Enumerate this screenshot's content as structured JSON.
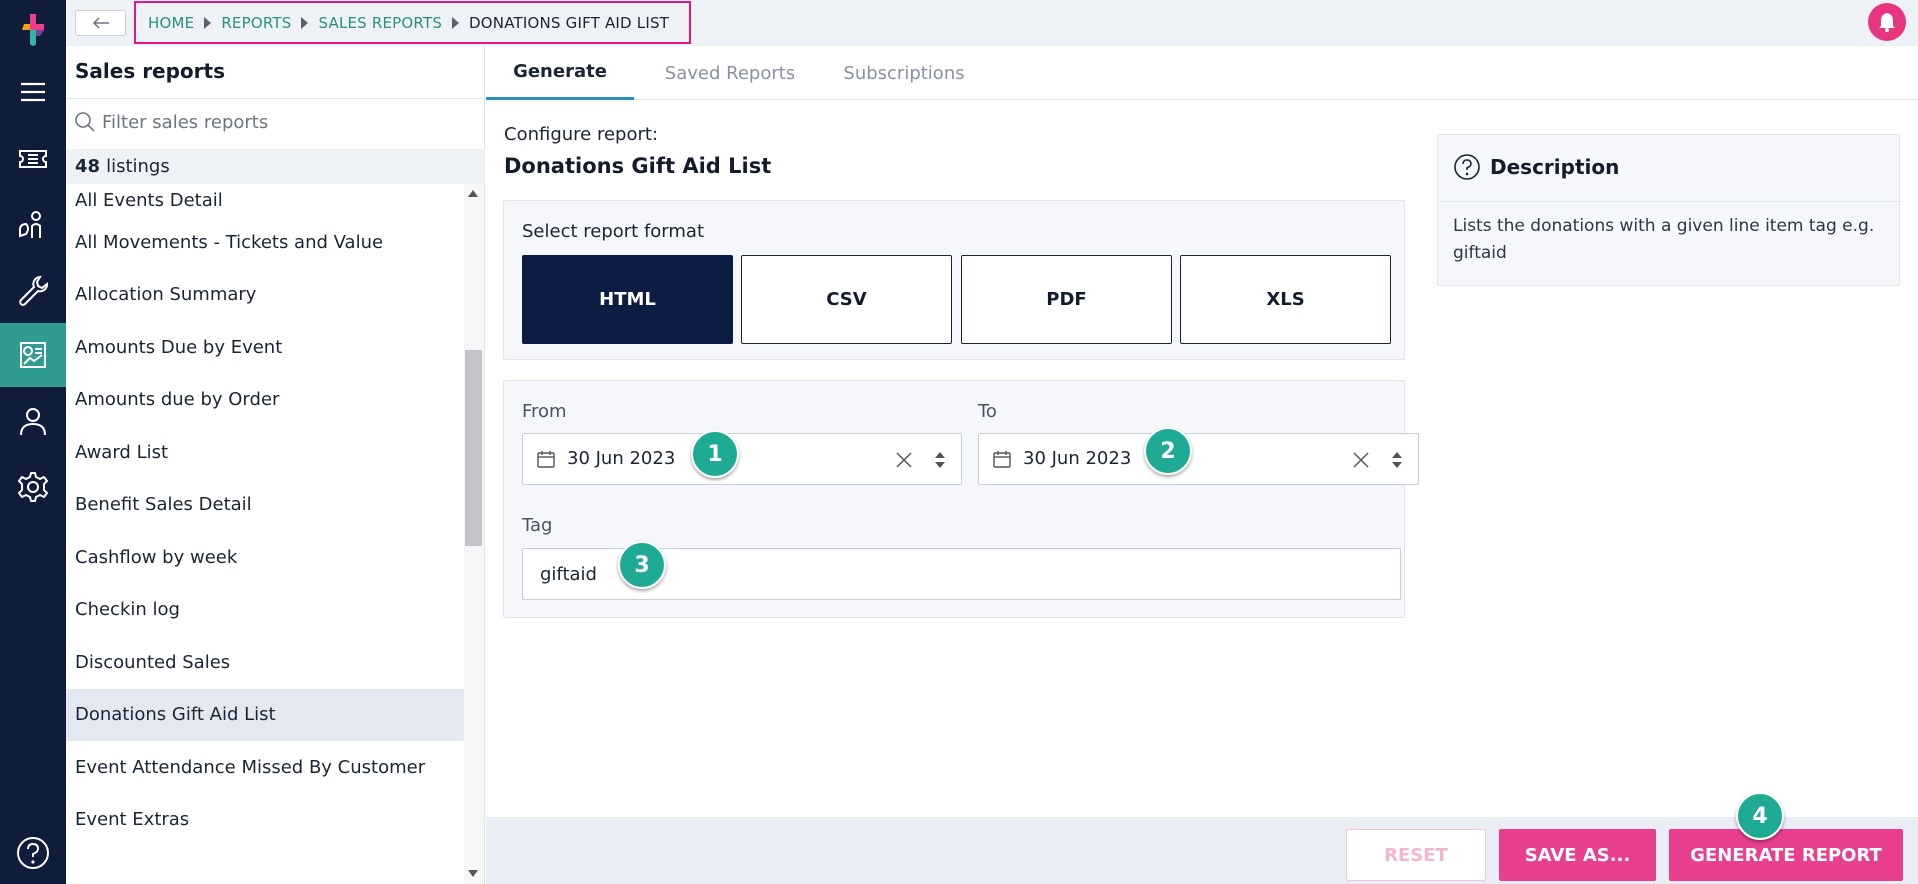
{
  "topbar": {
    "breadcrumb": [
      "HOME",
      "REPORTS",
      "SALES REPORTS"
    ],
    "breadcrumb_current": "DONATIONS GIFT AID LIST"
  },
  "sidebar": {
    "title": "Sales reports",
    "filter_placeholder": "Filter sales reports",
    "listings_count": "48",
    "listings_label": "listings",
    "items": [
      "All Events Detail",
      "All Movements - Tickets and Value",
      "Allocation Summary",
      "Amounts Due by Event",
      "Amounts due by Order",
      "Award List",
      "Benefit Sales Detail",
      "Cashflow by week",
      "Checkin log",
      "Discounted Sales",
      "Donations Gift Aid List",
      "Event Attendance Missed By Customer",
      "Event Extras"
    ],
    "selected_item": "Donations Gift Aid List"
  },
  "tabs": [
    "Generate",
    "Saved Reports",
    "Subscriptions"
  ],
  "active_tab": "Generate",
  "config": {
    "label": "Configure report:",
    "title": "Donations Gift Aid List"
  },
  "format": {
    "label": "Select report format",
    "options": [
      "HTML",
      "CSV",
      "PDF",
      "XLS"
    ],
    "selected": "HTML"
  },
  "dates": {
    "from_label": "From",
    "from_value": "30 Jun 2023",
    "to_label": "To",
    "to_value": "30 Jun 2023"
  },
  "tag": {
    "label": "Tag",
    "value": "giftaid"
  },
  "description": {
    "title": "Description",
    "text": "Lists the donations with a given line item tag e.g. giftaid"
  },
  "footer": {
    "reset": "RESET",
    "save_as": "SAVE AS...",
    "generate": "GENERATE REPORT"
  },
  "badges": [
    "1",
    "2",
    "3",
    "4"
  ],
  "colors": {
    "rail": "#0f1c3a",
    "rail_active": "#2f9c8f",
    "accent_pink": "#e8408c",
    "badge_teal": "#1faa93",
    "format_selected": "#0c1c42",
    "link_teal": "#2a8f82",
    "highlight_border": "#e0177c"
  },
  "icons": [
    "logo-icon",
    "menu-icon",
    "ticket-icon",
    "donate-icon",
    "wrench-icon",
    "reports-icon",
    "user-icon",
    "gear-icon",
    "help-icon",
    "bell-icon",
    "search-icon",
    "calendar-icon",
    "clear-icon",
    "spinner-icon",
    "question-circle-icon",
    "back-arrow-icon"
  ]
}
